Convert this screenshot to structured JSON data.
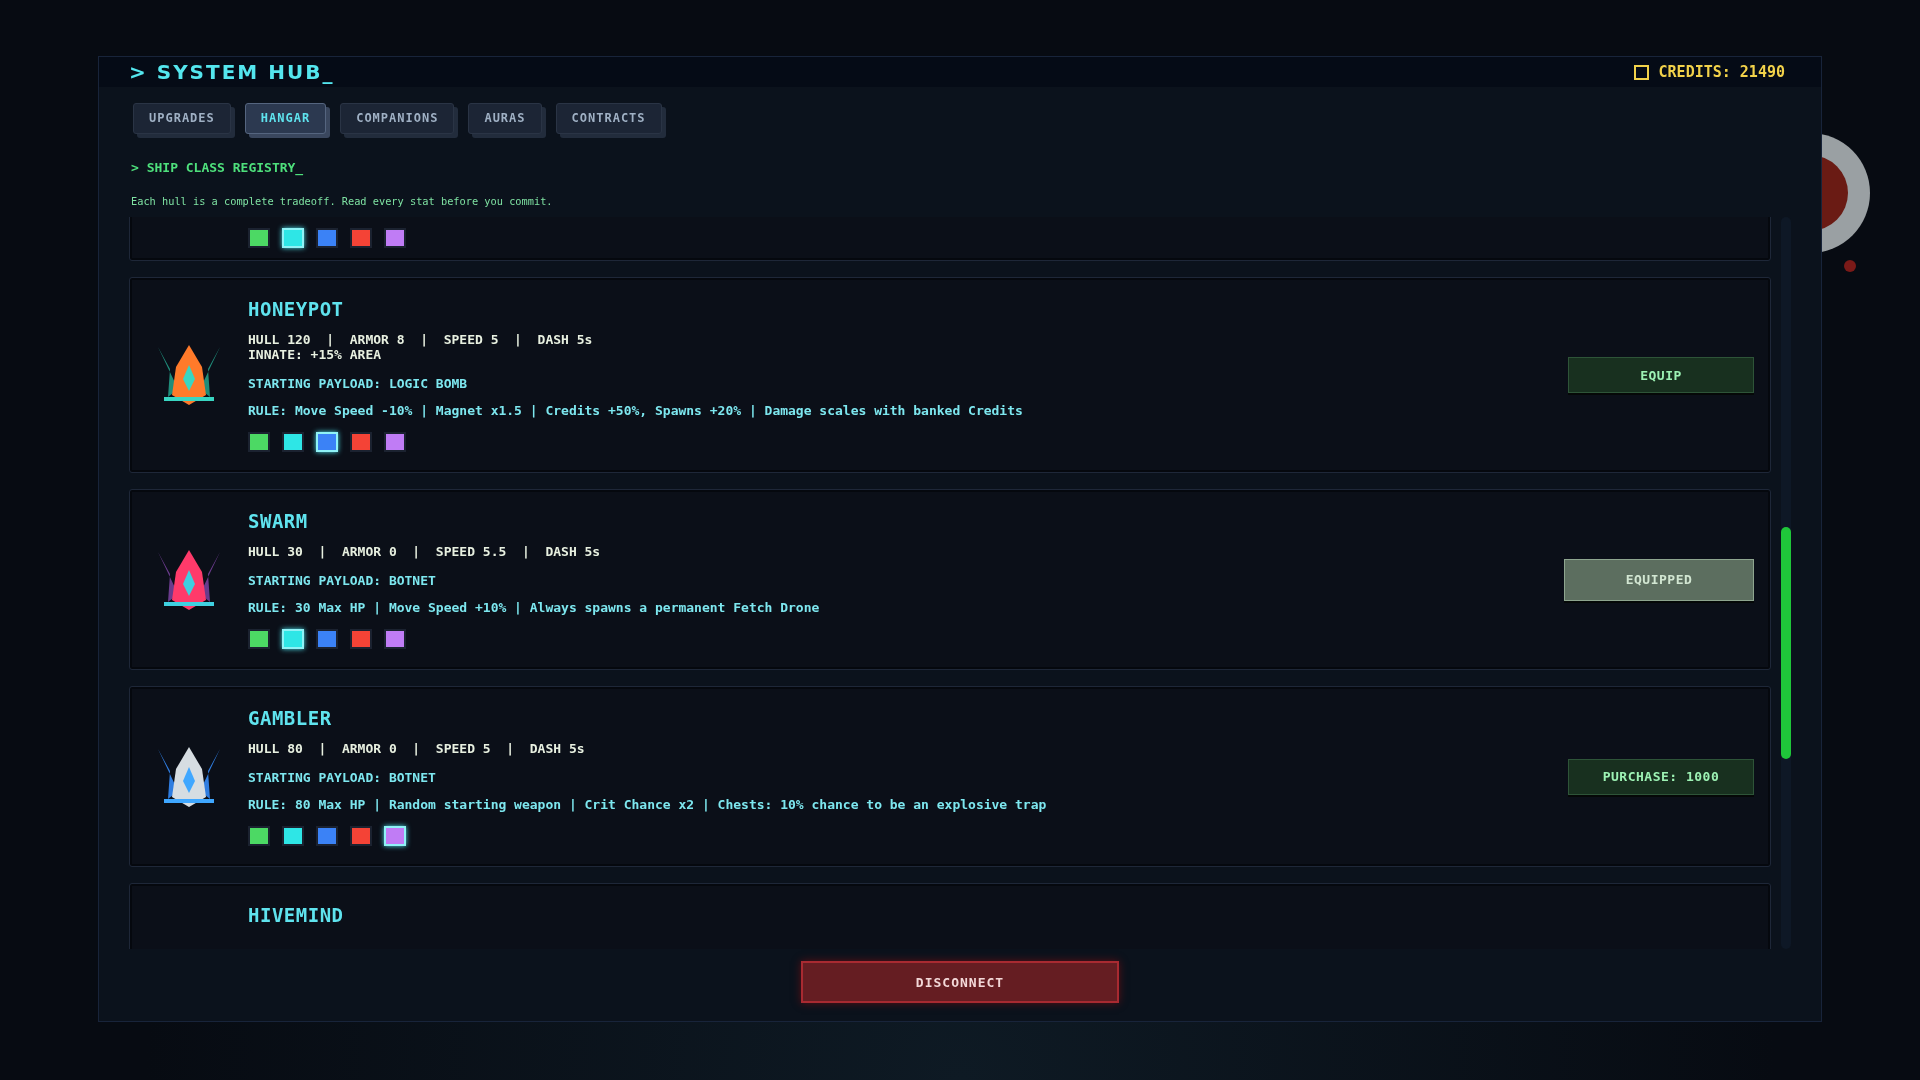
{
  "header": {
    "title": "> SYSTEM HUB_",
    "credits": "CREDITS: 21490"
  },
  "tabs": [
    {
      "label": "UPGRADES",
      "selected": false
    },
    {
      "label": "HANGAR",
      "selected": true
    },
    {
      "label": "COMPANIONS",
      "selected": false
    },
    {
      "label": "AURAS",
      "selected": false
    },
    {
      "label": "CONTRACTS",
      "selected": false
    }
  ],
  "section": {
    "title": "> SHIP CLASS REGISTRY_",
    "description": "Each hull is a complete tradeoff. Read every stat before you commit."
  },
  "ships": [
    {
      "colors": [
        {
          "color": "#4cd964",
          "selected": false
        },
        {
          "color": "#2ee6e6",
          "selected": true
        },
        {
          "color": "#3b82f6",
          "selected": false
        },
        {
          "color": "#f44336",
          "selected": false
        },
        {
          "color": "#c07cf5",
          "selected": false
        }
      ]
    },
    {
      "name": "HONEYPOT",
      "stats": "HULL 120  |  ARMOR 8  |  SPEED 5  |  DASH 5s",
      "innate": "INNATE: +15% AREA",
      "payload": "STARTING PAYLOAD: LOGIC BOMB",
      "rule": "RULE: Move Speed -10% | Magnet x1.5 | Credits +50%, Spawns +20% | Damage scales with banked Credits",
      "colors": [
        {
          "color": "#4cd964",
          "selected": false
        },
        {
          "color": "#2ee6e6",
          "selected": false
        },
        {
          "color": "#3b82f6",
          "selected": true
        },
        {
          "color": "#f44336",
          "selected": false
        },
        {
          "color": "#c07cf5",
          "selected": false
        }
      ],
      "action": {
        "kind": "equip",
        "label": "EQUIP"
      }
    },
    {
      "name": "SWARM",
      "stats": "HULL 30  |  ARMOR 0  |  SPEED 5.5  |  DASH 5s",
      "payload": "STARTING PAYLOAD: BOTNET",
      "rule": "RULE: 30 Max HP | Move Speed +10% | Always spawns a permanent Fetch Drone",
      "colors": [
        {
          "color": "#4cd964",
          "selected": false
        },
        {
          "color": "#2ee6e6",
          "selected": true
        },
        {
          "color": "#3b82f6",
          "selected": false
        },
        {
          "color": "#f44336",
          "selected": false
        },
        {
          "color": "#c07cf5",
          "selected": false
        }
      ],
      "action": {
        "kind": "equipped",
        "label": "EQUIPPED"
      }
    },
    {
      "name": "GAMBLER",
      "stats": "HULL 80  |  ARMOR 0  |  SPEED 5  |  DASH 5s",
      "payload": "STARTING PAYLOAD: BOTNET",
      "rule": "RULE: 80 Max HP | Random starting weapon | Crit Chance x2 | Chests: 10% chance to be an explosive trap",
      "colors": [
        {
          "color": "#4cd964",
          "selected": false
        },
        {
          "color": "#2ee6e6",
          "selected": false
        },
        {
          "color": "#3b82f6",
          "selected": false
        },
        {
          "color": "#f44336",
          "selected": false
        },
        {
          "color": "#c07cf5",
          "selected": true
        }
      ],
      "action": {
        "kind": "purchase",
        "label": "PURCHASE: 1000"
      }
    },
    {
      "name": "HIVEMIND"
    }
  ],
  "footer": {
    "button": "DISCONNECT"
  }
}
